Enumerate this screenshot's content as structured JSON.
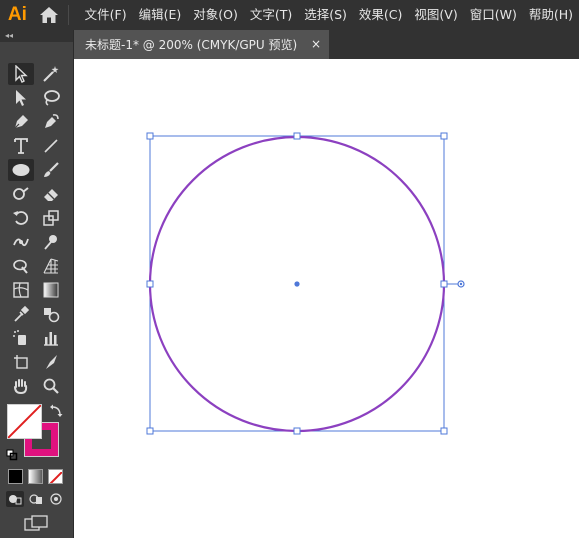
{
  "app": {
    "logo": "Ai"
  },
  "menu": {
    "items": [
      {
        "label": "文件(F)"
      },
      {
        "label": "编辑(E)"
      },
      {
        "label": "对象(O)"
      },
      {
        "label": "文字(T)"
      },
      {
        "label": "选择(S)"
      },
      {
        "label": "效果(C)"
      },
      {
        "label": "视图(V)"
      },
      {
        "label": "窗口(W)"
      },
      {
        "label": "帮助(H)"
      }
    ]
  },
  "toolbar": {
    "collapse_label": "◂◂",
    "tools": [
      [
        "selection-tool",
        "magic-wand-tool"
      ],
      [
        "direct-selection-tool",
        "lasso-tool"
      ],
      [
        "pen-tool",
        "curvature-tool"
      ],
      [
        "type-tool",
        "line-segment-tool"
      ],
      [
        "ellipse-tool",
        "paintbrush-tool"
      ],
      [
        "shaper-tool",
        "eraser-tool"
      ],
      [
        "rotate-tool",
        "scale-tool"
      ],
      [
        "width-tool",
        "puppet-warp-tool"
      ],
      [
        "shape-builder-tool",
        "perspective-grid-tool"
      ],
      [
        "mesh-tool",
        "gradient-tool"
      ],
      [
        "eyedropper-tool",
        "blend-tool"
      ],
      [
        "symbol-sprayer-tool",
        "column-graph-tool"
      ],
      [
        "artboard-tool",
        "slice-tool"
      ],
      [
        "hand-tool",
        "zoom-tool"
      ]
    ],
    "active_tool": "ellipse-tool",
    "fill_color": "none",
    "stroke_color": "#e0127f"
  },
  "document": {
    "tab_title": "未标题-1* @ 200% (CMYK/GPU 预览)",
    "close_glyph": "×"
  },
  "artwork": {
    "shape": "circle",
    "stroke_color": "#8c40c0",
    "selection_color": "#4f78d8"
  },
  "colors": {
    "menu_bg": "#323232",
    "toolbar_bg": "#424242",
    "panel_bg": "#535353",
    "canvas_bg": "#ffffff",
    "logo": "#ff9a00"
  }
}
